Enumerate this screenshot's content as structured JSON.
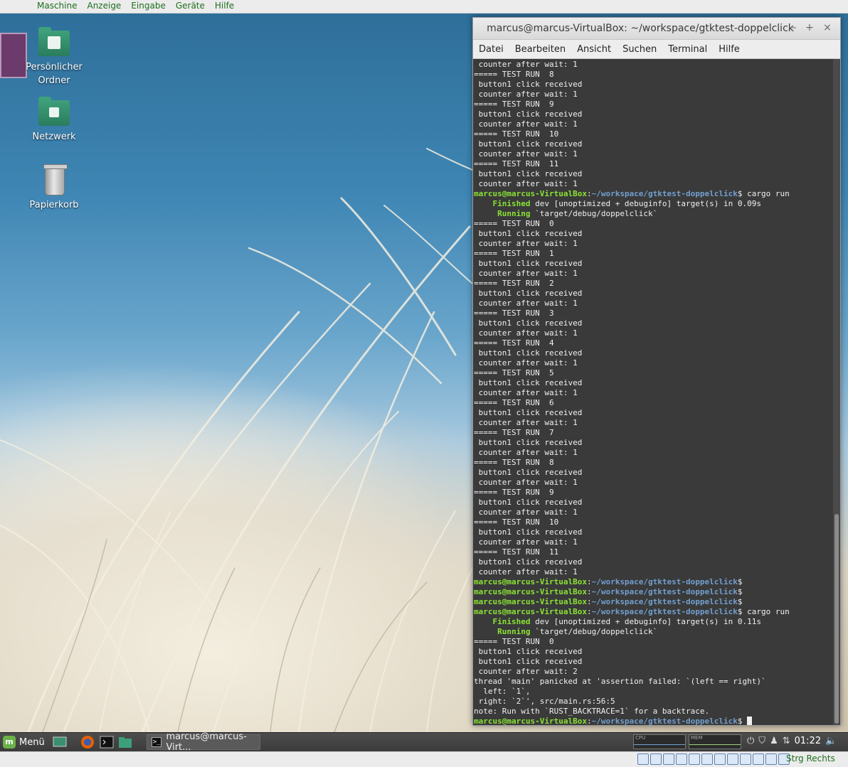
{
  "vbox_menu": [
    "Maschine",
    "Anzeige",
    "Eingabe",
    "Geräte",
    "Hilfe"
  ],
  "desktop_icons": [
    {
      "label": "Persönlicher Ordner",
      "icon": "home-folder-icon"
    },
    {
      "label": "Netzwerk",
      "icon": "network-folder-icon"
    },
    {
      "label": "Papierkorb",
      "icon": "trash-icon"
    }
  ],
  "terminal": {
    "title": "marcus@marcus-VirtualBox: ~/workspace/gtktest-doppelclick",
    "controls": {
      "minimize": "–",
      "maximize": "+",
      "close": "×"
    },
    "menu": [
      "Datei",
      "Bearbeiten",
      "Ansicht",
      "Suchen",
      "Terminal",
      "Hilfe"
    ],
    "prompt_user": "marcus@marcus-VirtualBox",
    "prompt_path": "~/workspace/gtktest-doppelclick",
    "lines": [
      {
        "t": "text",
        "s": " counter after wait: 1"
      },
      {
        "t": "text",
        "s": "===== TEST RUN  8"
      },
      {
        "t": "text",
        "s": " button1 click received"
      },
      {
        "t": "text",
        "s": " counter after wait: 1"
      },
      {
        "t": "text",
        "s": "===== TEST RUN  9"
      },
      {
        "t": "text",
        "s": " button1 click received"
      },
      {
        "t": "text",
        "s": " counter after wait: 1"
      },
      {
        "t": "text",
        "s": "===== TEST RUN  10"
      },
      {
        "t": "text",
        "s": " button1 click received"
      },
      {
        "t": "text",
        "s": " counter after wait: 1"
      },
      {
        "t": "text",
        "s": "===== TEST RUN  11"
      },
      {
        "t": "text",
        "s": " button1 click received"
      },
      {
        "t": "text",
        "s": " counter after wait: 1"
      },
      {
        "t": "prompt",
        "s": " cargo run"
      },
      {
        "t": "status",
        "k": "    Finished",
        "s": " dev [unoptimized + debuginfo] target(s) in 0.09s"
      },
      {
        "t": "status",
        "k": "     Running",
        "s": " `target/debug/doppelclick`"
      },
      {
        "t": "text",
        "s": "===== TEST RUN  0"
      },
      {
        "t": "text",
        "s": " button1 click received"
      },
      {
        "t": "text",
        "s": " counter after wait: 1"
      },
      {
        "t": "text",
        "s": "===== TEST RUN  1"
      },
      {
        "t": "text",
        "s": " button1 click received"
      },
      {
        "t": "text",
        "s": " counter after wait: 1"
      },
      {
        "t": "text",
        "s": "===== TEST RUN  2"
      },
      {
        "t": "text",
        "s": " button1 click received"
      },
      {
        "t": "text",
        "s": " counter after wait: 1"
      },
      {
        "t": "text",
        "s": "===== TEST RUN  3"
      },
      {
        "t": "text",
        "s": " button1 click received"
      },
      {
        "t": "text",
        "s": " counter after wait: 1"
      },
      {
        "t": "text",
        "s": "===== TEST RUN  4"
      },
      {
        "t": "text",
        "s": " button1 click received"
      },
      {
        "t": "text",
        "s": " counter after wait: 1"
      },
      {
        "t": "text",
        "s": "===== TEST RUN  5"
      },
      {
        "t": "text",
        "s": " button1 click received"
      },
      {
        "t": "text",
        "s": " counter after wait: 1"
      },
      {
        "t": "text",
        "s": "===== TEST RUN  6"
      },
      {
        "t": "text",
        "s": " button1 click received"
      },
      {
        "t": "text",
        "s": " counter after wait: 1"
      },
      {
        "t": "text",
        "s": "===== TEST RUN  7"
      },
      {
        "t": "text",
        "s": " button1 click received"
      },
      {
        "t": "text",
        "s": " counter after wait: 1"
      },
      {
        "t": "text",
        "s": "===== TEST RUN  8"
      },
      {
        "t": "text",
        "s": " button1 click received"
      },
      {
        "t": "text",
        "s": " counter after wait: 1"
      },
      {
        "t": "text",
        "s": "===== TEST RUN  9"
      },
      {
        "t": "text",
        "s": " button1 click received"
      },
      {
        "t": "text",
        "s": " counter after wait: 1"
      },
      {
        "t": "text",
        "s": "===== TEST RUN  10"
      },
      {
        "t": "text",
        "s": " button1 click received"
      },
      {
        "t": "text",
        "s": " counter after wait: 1"
      },
      {
        "t": "text",
        "s": "===== TEST RUN  11"
      },
      {
        "t": "text",
        "s": " button1 click received"
      },
      {
        "t": "text",
        "s": " counter after wait: 1"
      },
      {
        "t": "prompt",
        "s": ""
      },
      {
        "t": "prompt",
        "s": ""
      },
      {
        "t": "prompt",
        "s": ""
      },
      {
        "t": "prompt",
        "s": " cargo run"
      },
      {
        "t": "status",
        "k": "    Finished",
        "s": " dev [unoptimized + debuginfo] target(s) in 0.11s"
      },
      {
        "t": "status",
        "k": "     Running",
        "s": " `target/debug/doppelclick`"
      },
      {
        "t": "text",
        "s": "===== TEST RUN  0"
      },
      {
        "t": "text",
        "s": " button1 click received"
      },
      {
        "t": "text",
        "s": " button1 click received"
      },
      {
        "t": "text",
        "s": " counter after wait: 2"
      },
      {
        "t": "text",
        "s": "thread 'main' panicked at 'assertion failed: `(left == right)`"
      },
      {
        "t": "text",
        "s": "  left: `1`,"
      },
      {
        "t": "text",
        "s": " right: `2`', src/main.rs:56:5"
      },
      {
        "t": "text",
        "s": "note: Run with `RUST_BACKTRACE=1` for a backtrace."
      },
      {
        "t": "prompt",
        "s": " ",
        "cursor": true
      }
    ]
  },
  "panel": {
    "menu_label": "Menü",
    "mint_logo": "m",
    "task_label": "marcus@marcus-Virt...",
    "cpu_label": "CPU",
    "mem_label": "MEM",
    "clock": "01:22"
  },
  "vbox_status": {
    "host_key": "Strg Rechts"
  }
}
